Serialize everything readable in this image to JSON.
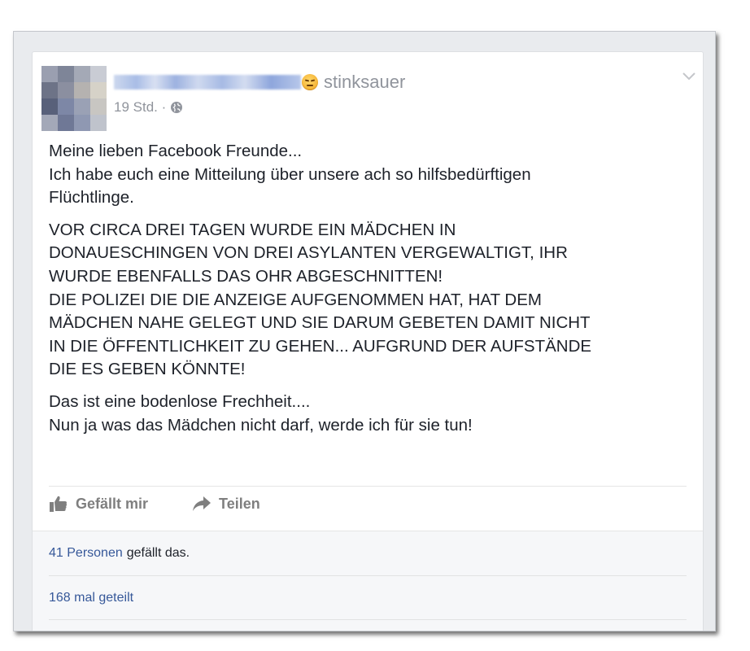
{
  "post": {
    "feeling": "stinksauer",
    "timestamp": "19 Std. ·",
    "privacy_icon": "globe-icon",
    "paragraphs": [
      [
        "Meine lieben Facebook Freunde...",
        "Ich habe euch eine Mitteilung über unsere ach so hilfsbedürftigen",
        "Flüchtlinge."
      ],
      [
        "VOR CIRCA DREI TAGEN WURDE EIN MÄDCHEN IN",
        "DONAUESCHINGEN VON DREI ASYLANTEN VERGEWALTIGT, IHR",
        "WURDE EBENFALLS DAS OHR ABGESCHNITTEN!",
        "DIE POLIZEI DIE DIE ANZEIGE AUFGENOMMEN HAT, HAT DEM",
        "MÄDCHEN NAHE GELEGT UND SIE DARUM GEBETEN DAMIT NICHT",
        "IN DIE ÖFFENTLICHKEIT ZU GEHEN... AUFGRUND DER AUFSTÄNDE",
        "DIE ES GEBEN KÖNNTE!"
      ],
      [
        "Das ist eine bodenlose Frechheit....",
        "Nun ja was das Mädchen nicht darf, werde ich für sie tun!"
      ]
    ]
  },
  "actions": {
    "like_label": "Gefällt mir",
    "share_label": "Teilen"
  },
  "summary": {
    "likes_link": "41 Personen",
    "likes_suffix": "gefällt das.",
    "shares_link": "168 mal geteilt"
  },
  "colors": {
    "link": "#365899",
    "meta_grey": "#90949c",
    "text": "#1d2129"
  }
}
